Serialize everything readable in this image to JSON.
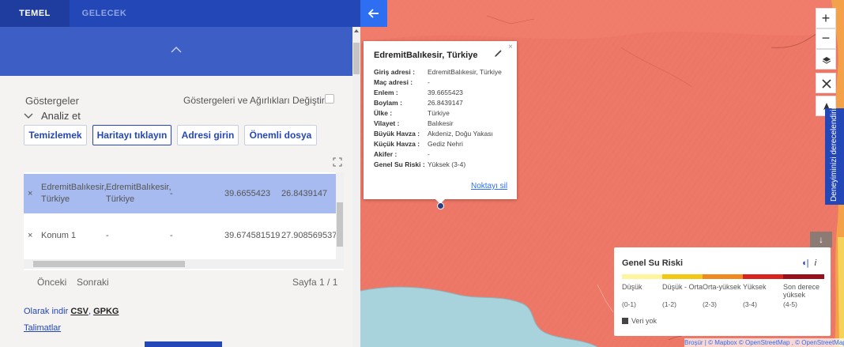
{
  "tabs": [
    {
      "label": "TEMEL"
    },
    {
      "label": "GELECEK"
    }
  ],
  "panel": {
    "indicators_title": "Göstergeler",
    "change_indicators_label": "Göstergeleri ve Ağırlıkları Değiştirin",
    "analyze_label": "Analiz et",
    "buttons": {
      "clear": "Temizlemek",
      "click_map": "Haritayı tıklayın",
      "enter_address": "Adresi girin",
      "important_file": "Önemli dosya"
    },
    "table": {
      "rows": [
        {
          "remove": "×",
          "input": "EdremitBalıkesir, Türkiye",
          "match": "EdremitBalıkesir, Türkiye",
          "extra": "-",
          "lat": "39.6655423",
          "lon": "26.8439147"
        },
        {
          "remove": "×",
          "input": "Konum 1",
          "match": "-",
          "extra": "-",
          "lat": "39.674581519",
          "lon": "27.908569537"
        }
      ]
    },
    "pager": {
      "prev": "Önceki",
      "next": "Sonraki",
      "page": "Sayfa 1 / 1"
    },
    "download": {
      "prefix": "Olarak indir",
      "csv": "CSV",
      "comma": ",",
      "gpkg": "GPKG"
    },
    "instructions": "Talimatlar"
  },
  "popup": {
    "title": "EdremitBalıkesir, Türkiye",
    "close": "×",
    "fields": [
      {
        "key": "Giriş adresi :",
        "value": "EdremitBalıkesir, Türkiye"
      },
      {
        "key": "Maç adresi :",
        "value": "-"
      },
      {
        "key": "Enlem :",
        "value": "39.6655423"
      },
      {
        "key": "Boylam :",
        "value": "26.8439147"
      },
      {
        "key": "Ülke :",
        "value": "Türkiye"
      },
      {
        "key": "Vilayet :",
        "value": "Balıkesir"
      },
      {
        "key": "Büyük Havza :",
        "value": "Akdeniz, Doğu Yakası"
      },
      {
        "key": "Küçük Havza :",
        "value": "Gediz Nehri"
      },
      {
        "key": "Akifer :",
        "value": "-"
      },
      {
        "key": "Genel Su Riski :",
        "value": "Yüksek (3-4)"
      }
    ],
    "delete_link": "Noktayı sil"
  },
  "map_controls": {
    "zoom_in": "+",
    "zoom_out": "−",
    "down": "↓"
  },
  "feedback_tab": "Deneyiminizi derecelendirin",
  "legend": {
    "title": "Genel Su Riski",
    "info": "i",
    "categories": [
      {
        "label": "Düşük",
        "range": "(0-1)",
        "color": "#fff59c"
      },
      {
        "label": "Düşük - Orta",
        "range": "(1-2)",
        "color": "#f2c814"
      },
      {
        "label": "Orta-yüksek",
        "range": "(2-3)",
        "color": "#f08a1e"
      },
      {
        "label": "Yüksek",
        "range": "(3-4)",
        "color": "#d8231e"
      },
      {
        "label": "Son derece yüksek",
        "range": "(4-5)",
        "color": "#97101a"
      }
    ],
    "no_data": "Veri yok"
  },
  "attribution": "Broşür | © Mapbox © OpenStreetMap , © OpenStreetMap"
}
